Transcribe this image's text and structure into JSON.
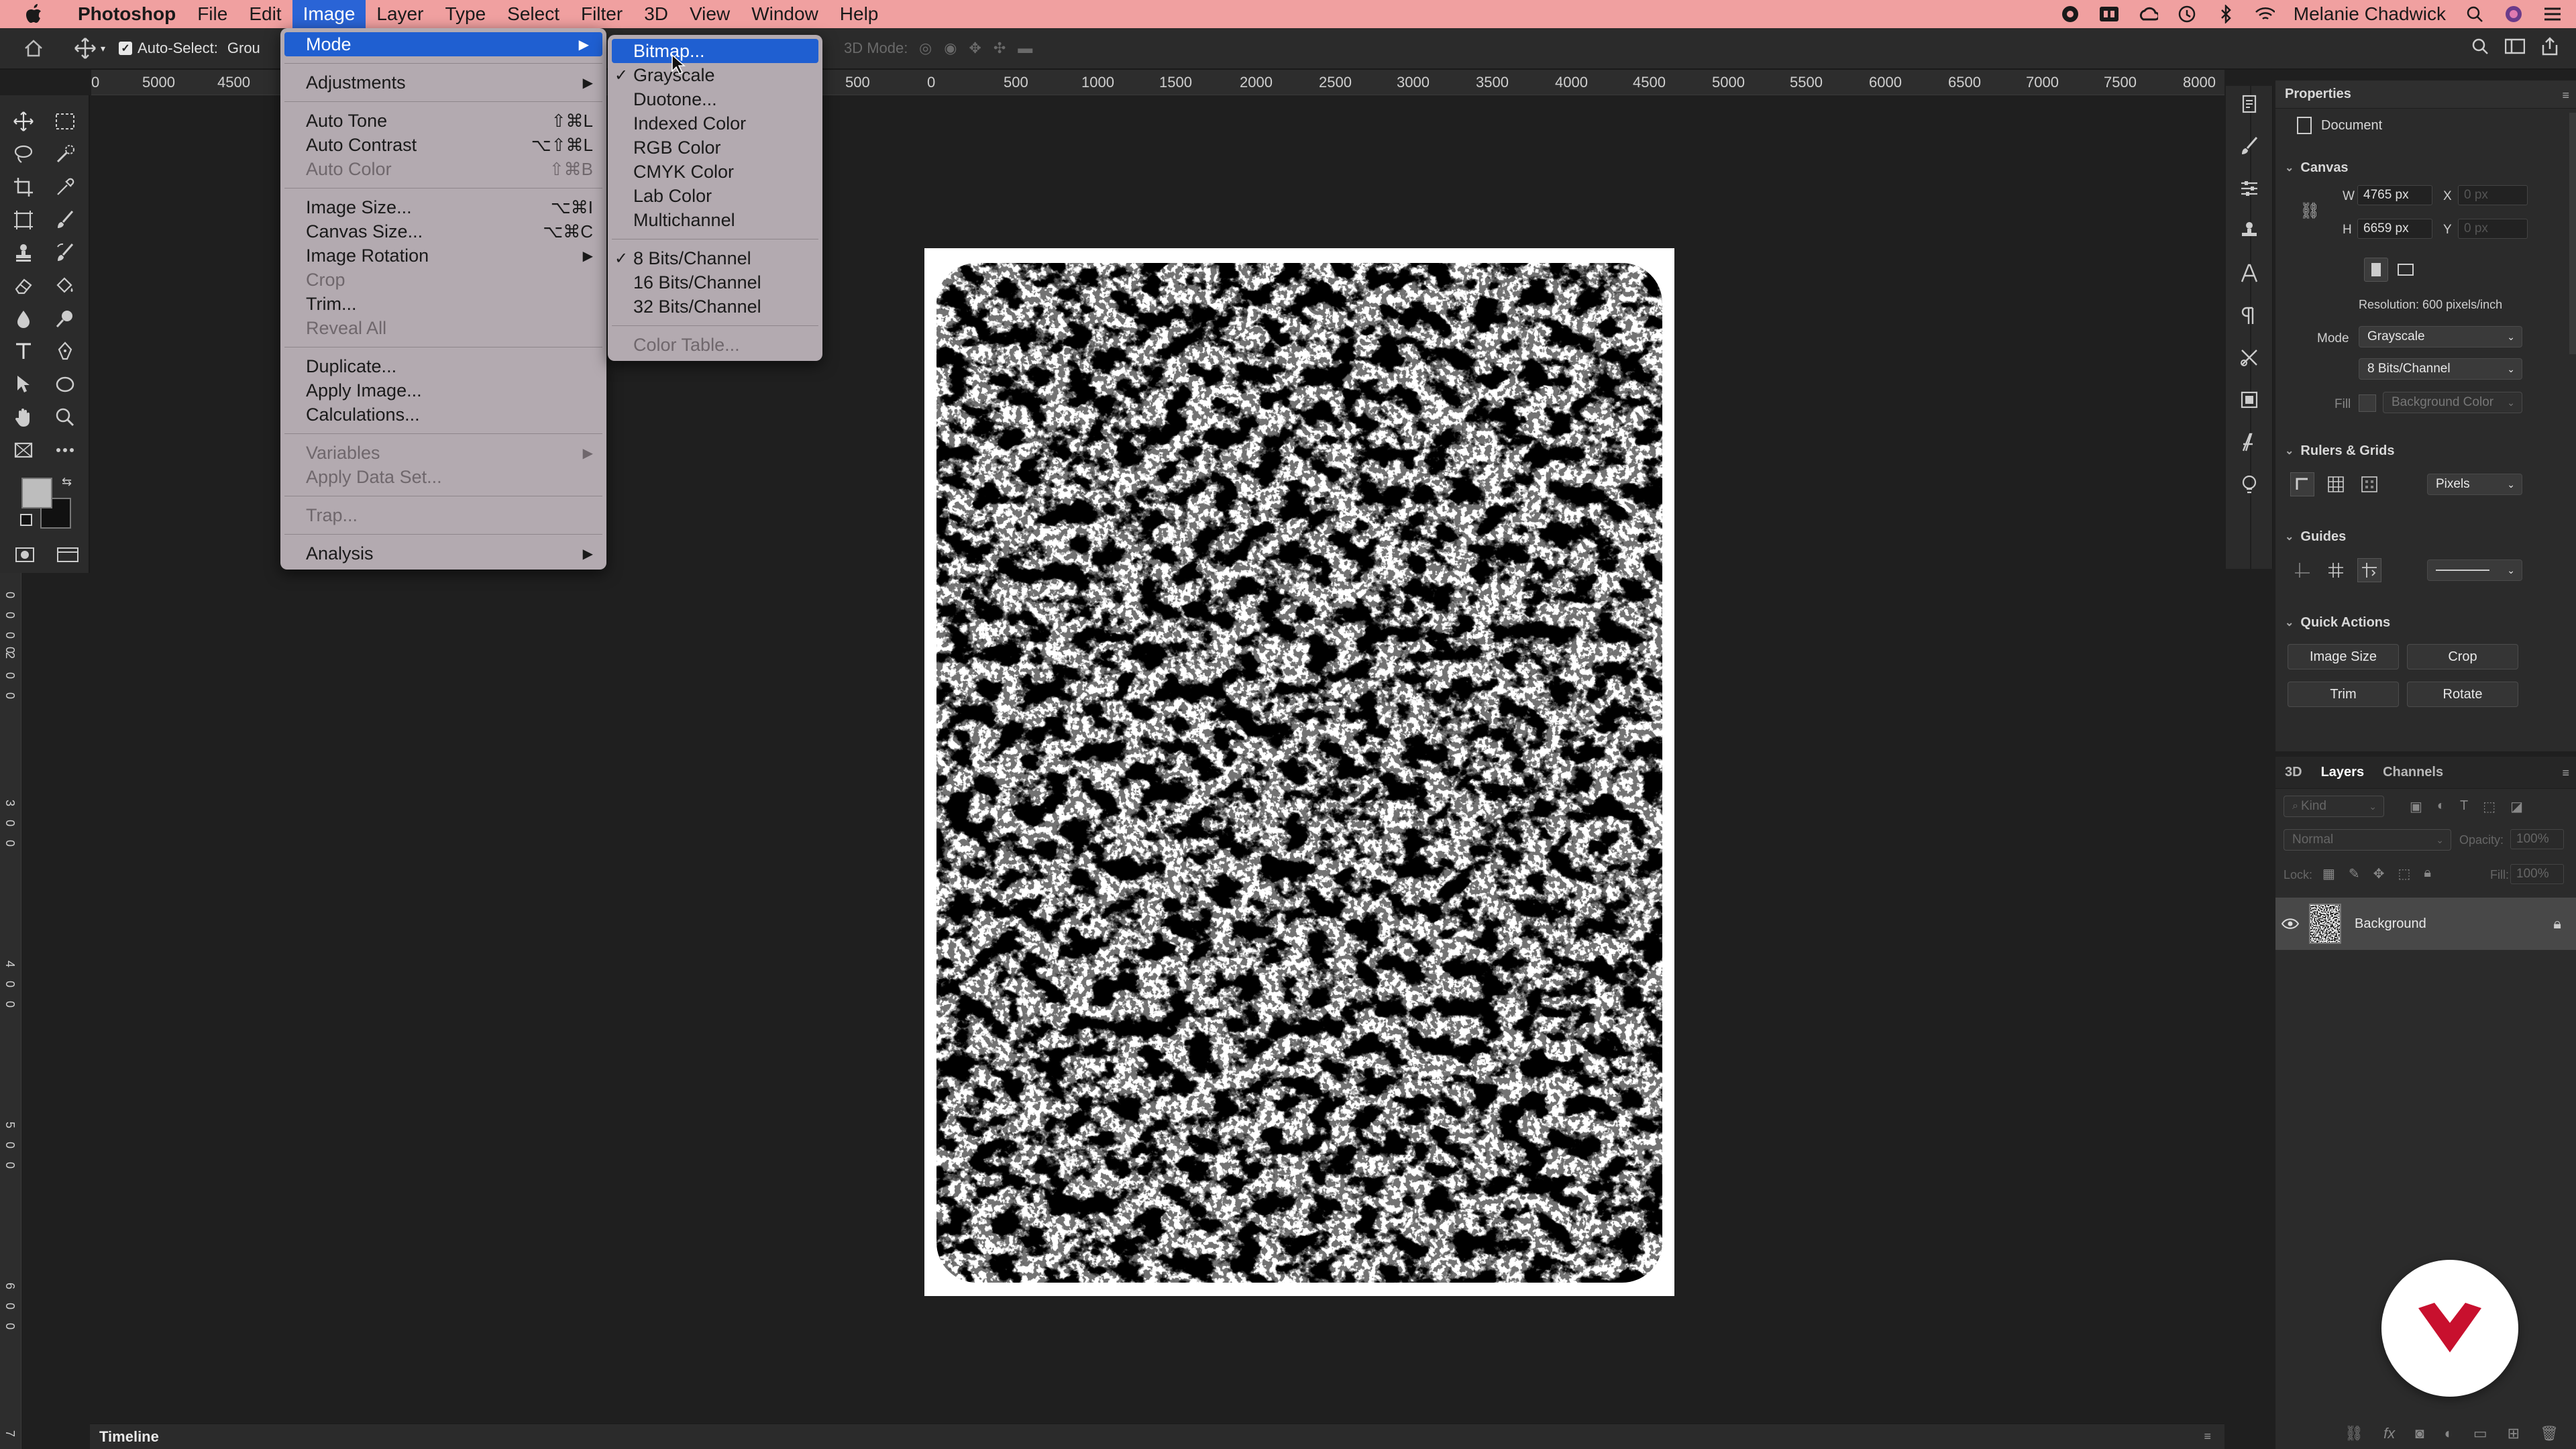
{
  "menubar": {
    "app_name": "Photoshop",
    "items": [
      "File",
      "Edit",
      "Image",
      "Layer",
      "Type",
      "Select",
      "Filter",
      "3D",
      "View",
      "Window",
      "Help"
    ],
    "active_item": "Image",
    "user_name": "Melanie Chadwick"
  },
  "options_bar": {
    "auto_select_label": "Auto-Select:",
    "auto_select_value": "Grou",
    "mode_3d_label": "3D Mode:"
  },
  "ruler": {
    "h_ticks": [
      "0",
      "5000",
      "4500",
      "500",
      "0",
      "500",
      "1000",
      "1500",
      "2000",
      "2500",
      "3000",
      "3500",
      "4000",
      "4500",
      "5000",
      "5500",
      "6000",
      "6500",
      "7000",
      "7500",
      "8000"
    ],
    "v_ticks": [
      "0",
      "0",
      "0",
      "0",
      "2",
      "0",
      "0",
      "3",
      "0",
      "0",
      "4",
      "0",
      "0",
      "5",
      "0",
      "0",
      "6",
      "0",
      "0",
      "7"
    ]
  },
  "image_menu": {
    "items": [
      {
        "label": "Mode",
        "shortcut": "",
        "submenu": true,
        "disabled": false,
        "highlight": true
      },
      {
        "sep": true
      },
      {
        "label": "Adjustments",
        "shortcut": "",
        "submenu": true,
        "disabled": false
      },
      {
        "sep": true
      },
      {
        "label": "Auto Tone",
        "shortcut": "⇧⌘L",
        "disabled": false
      },
      {
        "label": "Auto Contrast",
        "shortcut": "⌥⇧⌘L",
        "disabled": false
      },
      {
        "label": "Auto Color",
        "shortcut": "⇧⌘B",
        "disabled": true
      },
      {
        "sep": true
      },
      {
        "label": "Image Size...",
        "shortcut": "⌥⌘I",
        "disabled": false
      },
      {
        "label": "Canvas Size...",
        "shortcut": "⌥⌘C",
        "disabled": false
      },
      {
        "label": "Image Rotation",
        "shortcut": "",
        "submenu": true,
        "disabled": false
      },
      {
        "label": "Crop",
        "shortcut": "",
        "disabled": true
      },
      {
        "label": "Trim...",
        "shortcut": "",
        "disabled": false
      },
      {
        "label": "Reveal All",
        "shortcut": "",
        "disabled": true
      },
      {
        "sep": true
      },
      {
        "label": "Duplicate...",
        "shortcut": "",
        "disabled": false
      },
      {
        "label": "Apply Image...",
        "shortcut": "",
        "disabled": false
      },
      {
        "label": "Calculations...",
        "shortcut": "",
        "disabled": false
      },
      {
        "sep": true
      },
      {
        "label": "Variables",
        "shortcut": "",
        "submenu": true,
        "disabled": true
      },
      {
        "label": "Apply Data Set...",
        "shortcut": "",
        "disabled": true
      },
      {
        "sep": true
      },
      {
        "label": "Trap...",
        "shortcut": "",
        "disabled": true
      },
      {
        "sep": true
      },
      {
        "label": "Analysis",
        "shortcut": "",
        "submenu": true,
        "disabled": false
      }
    ]
  },
  "mode_submenu": {
    "items": [
      {
        "label": "Bitmap...",
        "checked": false,
        "highlight": true
      },
      {
        "label": "Grayscale",
        "checked": true
      },
      {
        "label": "Duotone...",
        "checked": false
      },
      {
        "label": "Indexed Color",
        "checked": false
      },
      {
        "label": "RGB Color",
        "checked": false
      },
      {
        "label": "CMYK Color",
        "checked": false
      },
      {
        "label": "Lab Color",
        "checked": false
      },
      {
        "label": "Multichannel",
        "checked": false
      },
      {
        "sep": true
      },
      {
        "label": "8 Bits/Channel",
        "checked": true
      },
      {
        "label": "16 Bits/Channel",
        "checked": false
      },
      {
        "label": "32 Bits/Channel",
        "checked": false
      },
      {
        "sep": true
      },
      {
        "label": "Color Table...",
        "checked": false,
        "disabled": true
      }
    ]
  },
  "properties": {
    "title": "Properties",
    "doc_label": "Document",
    "canvas": {
      "title": "Canvas",
      "w_label": "W",
      "w": "4765 px",
      "h_label": "H",
      "h": "6659 px",
      "x_label": "X",
      "x_placeholder": "0 px",
      "y_label": "Y",
      "y_placeholder": "0 px",
      "resolution": "Resolution: 600 pixels/inch",
      "mode_label": "Mode",
      "mode": "Grayscale",
      "bits": "8 Bits/Channel",
      "fill_label": "Fill",
      "fill": "Background Color"
    },
    "rulers": {
      "title": "Rulers & Grids",
      "unit": "Pixels"
    },
    "guides": {
      "title": "Guides"
    },
    "quick_actions": {
      "title": "Quick Actions",
      "buttons": [
        "Image Size",
        "Crop",
        "Trim",
        "Rotate"
      ]
    }
  },
  "layers": {
    "tabs": [
      "3D",
      "Layers",
      "Channels"
    ],
    "active_tab": "Layers",
    "kind_placeholder": "Kind",
    "blend": "Normal",
    "opacity_label": "Opacity:",
    "opacity": "100%",
    "lock_label": "Lock:",
    "fill_label": "Fill:",
    "fill": "100%",
    "layer_name": "Background"
  },
  "timeline": {
    "label": "Timeline"
  },
  "colors": {
    "menubar": "#f0a0a0",
    "highlight": "#1f5fd1",
    "brand": "#c8102e"
  }
}
